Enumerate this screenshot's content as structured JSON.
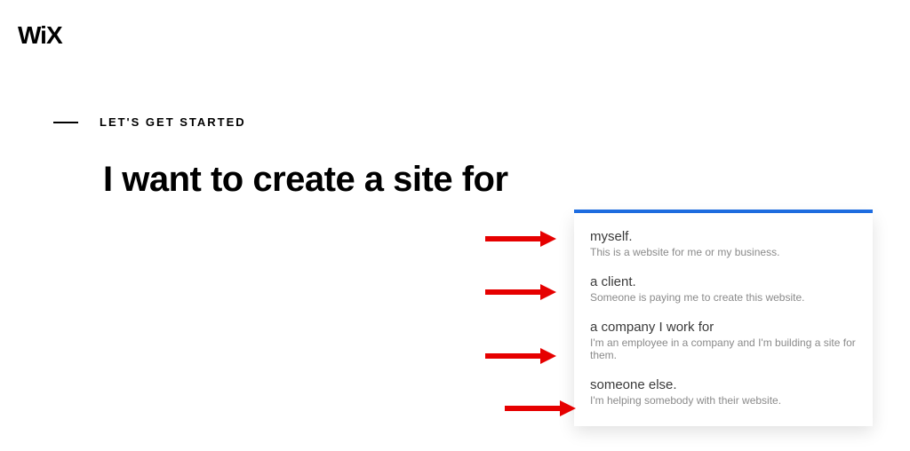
{
  "brand": {
    "logo_text": "WiX"
  },
  "intro": {
    "eyebrow": "LET'S GET STARTED"
  },
  "headline": "I want to create a site for",
  "dropdown": {
    "accent": "#1f6fe5",
    "options": [
      {
        "title": "myself.",
        "desc": "This is a website for me or my business."
      },
      {
        "title": "a client.",
        "desc": "Someone is paying me to create this website."
      },
      {
        "title": "a company I work for",
        "desc": "I'm an employee in a company and I'm building a site for them."
      },
      {
        "title": "someone else.",
        "desc": "I'm helping somebody with their website."
      }
    ]
  }
}
